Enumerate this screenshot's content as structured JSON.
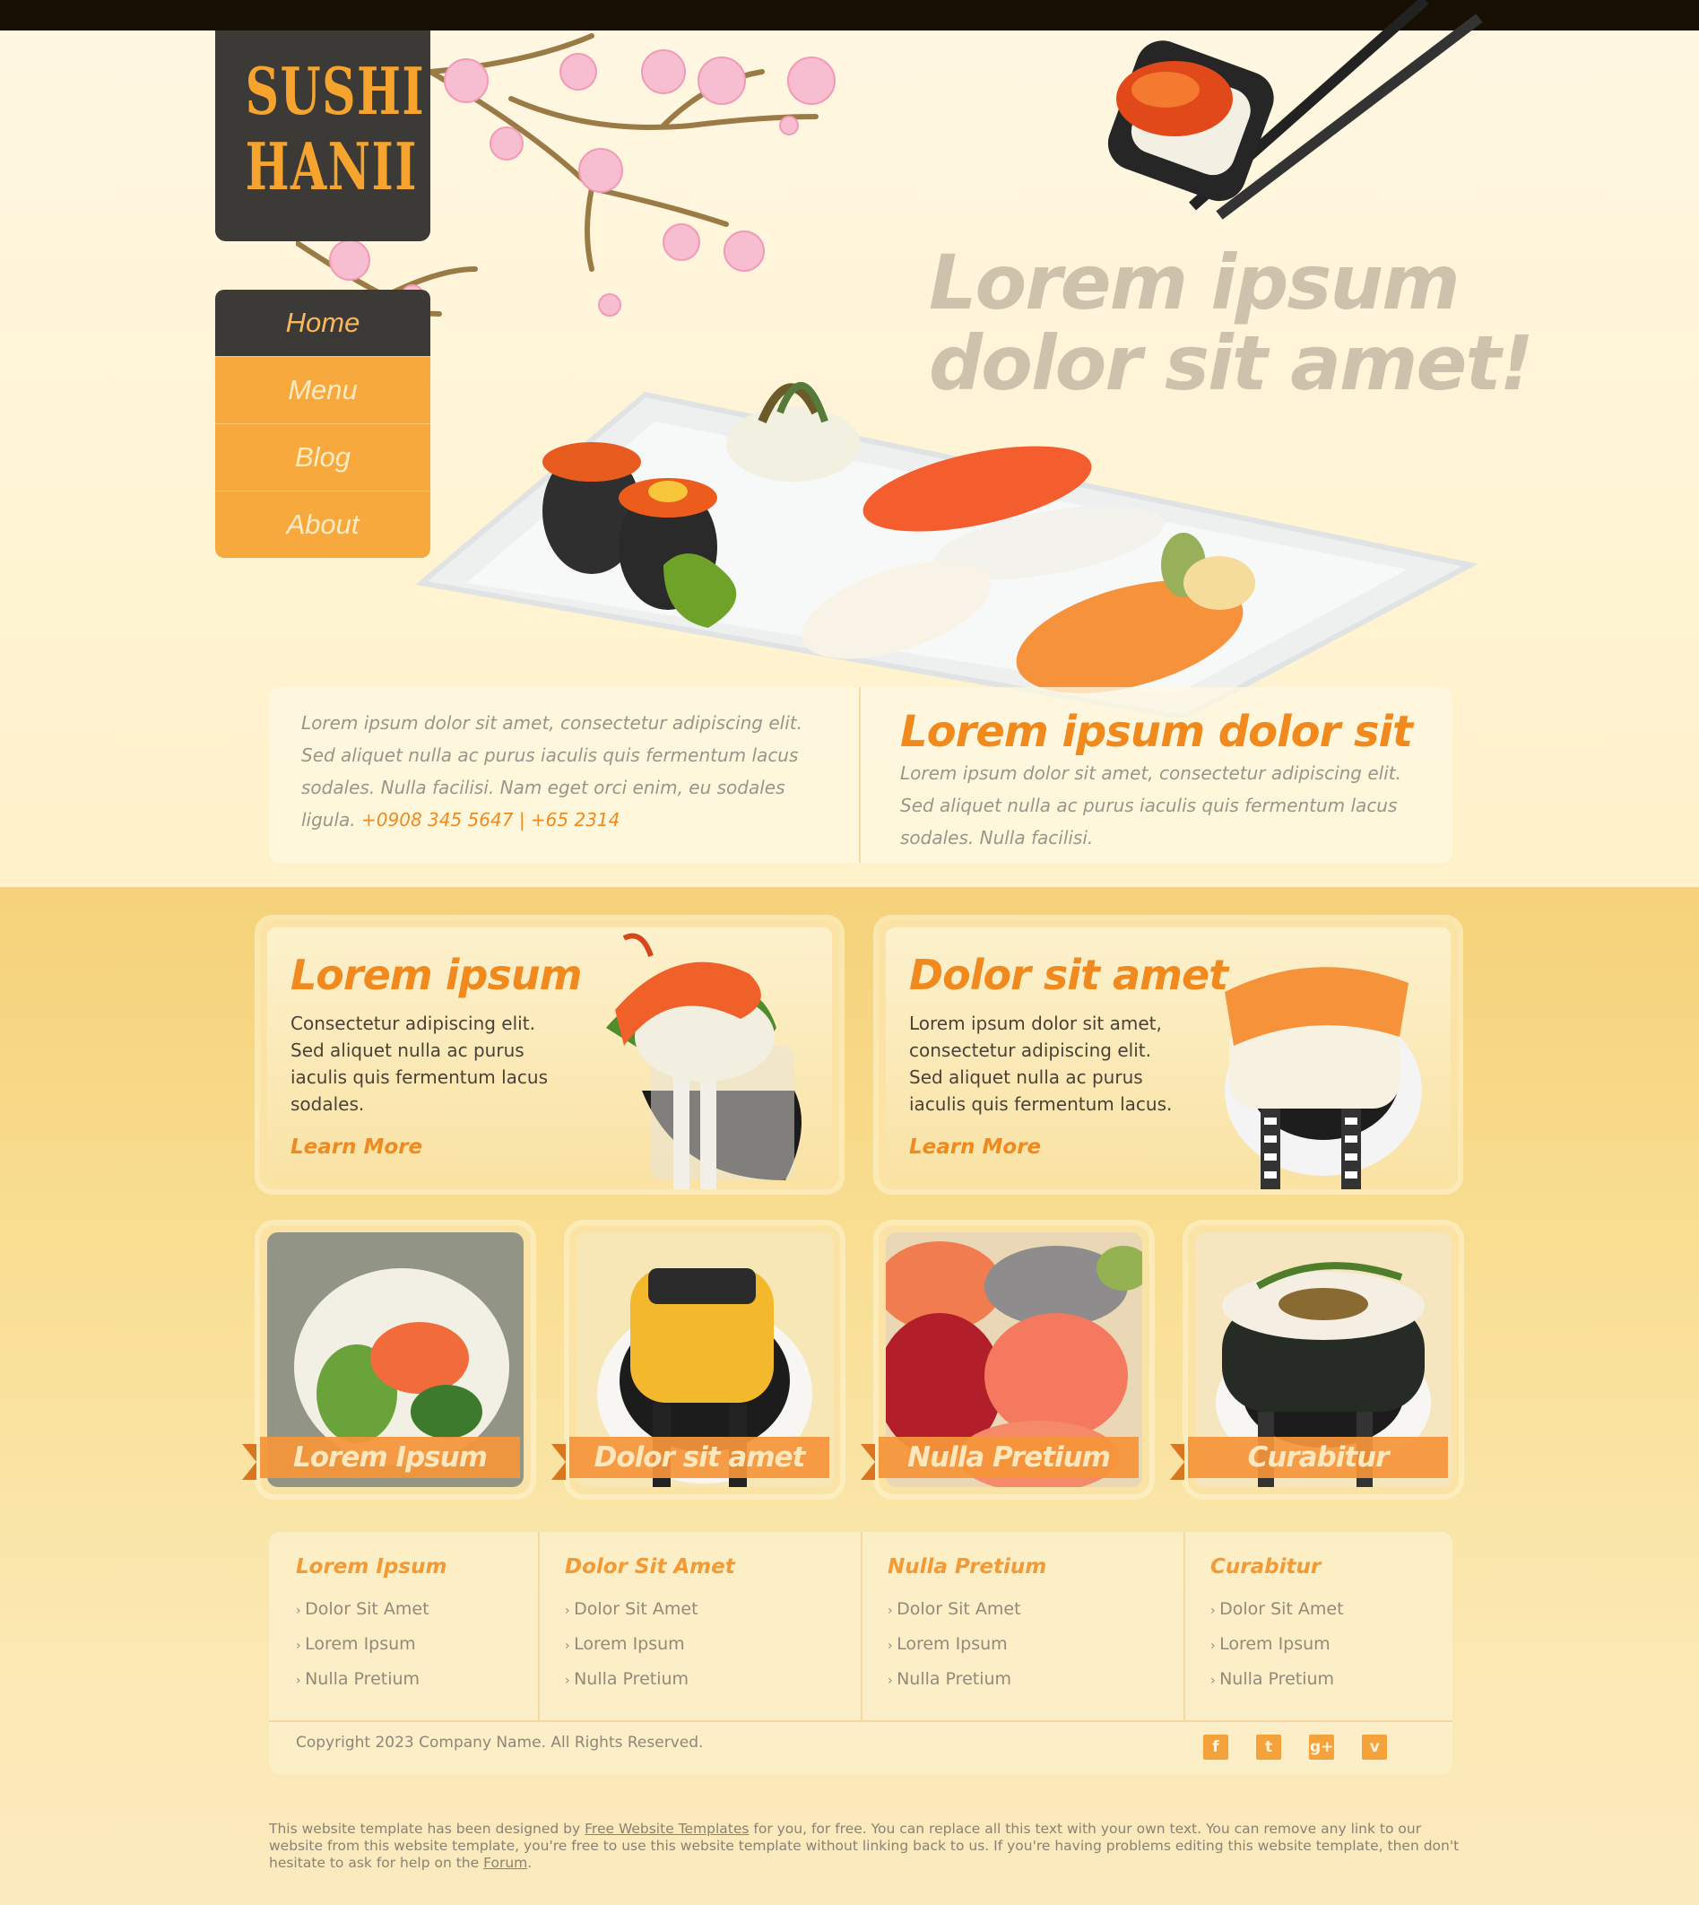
{
  "brand": {
    "line1": "SUSHI",
    "line2": "HANII"
  },
  "nav": {
    "items": [
      "Home",
      "Menu",
      "Blog",
      "About"
    ],
    "active": "Home"
  },
  "hero": {
    "line1": "Lorem ipsum",
    "line2": "dolor sit amet!"
  },
  "info": {
    "left_text": "Lorem ipsum dolor sit amet, consectetur adipiscing elit. Sed aliquet nulla ac purus iaculis quis fermentum lacus sodales. Nulla facilisi. Nam eget orci enim, eu sodales ligula.",
    "phone": "+0908 345 5647 | +65 2314",
    "right_title": "Lorem ipsum dolor sit",
    "right_text": "Lorem ipsum dolor sit amet, consectetur adipiscing elit. Sed aliquet nulla ac purus iaculis quis fermentum lacus sodales. Nulla facilisi."
  },
  "features": [
    {
      "title": "Lorem ipsum",
      "text": "Consectetur adipiscing elit. Sed aliquet nulla ac purus iaculis quis fermentum lacus sodales.",
      "link": "Learn More"
    },
    {
      "title": "Dolor sit amet",
      "text": "Lorem ipsum dolor sit amet, consectetur adipiscing elit. Sed aliquet nulla ac purus iaculis quis fermentum lacus.",
      "link": "Learn More"
    }
  ],
  "gallery": [
    "Lorem Ipsum",
    "Dolor sit amet",
    "Nulla Pretium",
    "Curabitur"
  ],
  "footer_columns": [
    {
      "title": "Lorem Ipsum",
      "links": [
        "Dolor Sit Amet",
        "Lorem Ipsum",
        "Nulla Pretium"
      ]
    },
    {
      "title": "Dolor Sit Amet",
      "links": [
        "Dolor Sit Amet",
        "Lorem Ipsum",
        "Nulla Pretium"
      ]
    },
    {
      "title": "Nulla Pretium",
      "links": [
        "Dolor Sit Amet",
        "Lorem Ipsum",
        "Nulla Pretium"
      ]
    },
    {
      "title": "Curabitur",
      "links": [
        "Dolor Sit Amet",
        "Lorem Ipsum",
        "Nulla Pretium"
      ]
    }
  ],
  "copyright": "Copyright 2023 Company Name. All Rights Reserved.",
  "social": {
    "icons": [
      "facebook-icon",
      "twitter-icon",
      "google-plus-icon",
      "vimeo-icon"
    ],
    "glyphs": [
      "f",
      "t",
      "g+",
      "v"
    ]
  },
  "note": {
    "part1": "This website template has been designed by ",
    "link1": "Free Website Templates",
    "part2": " for you, for free. You can replace all this text with your own text. You can remove any link to our website from this website template, you're free to use this website template without linking back to us. If you're having problems editing this website template, then don't hesitate to ask for help on the ",
    "link2": "Forum",
    "part3": "."
  },
  "colors": {
    "accent": "#f08a1f",
    "dark": "#3b3a37",
    "nav": "#f8a93e",
    "topbar": "#170f02"
  }
}
